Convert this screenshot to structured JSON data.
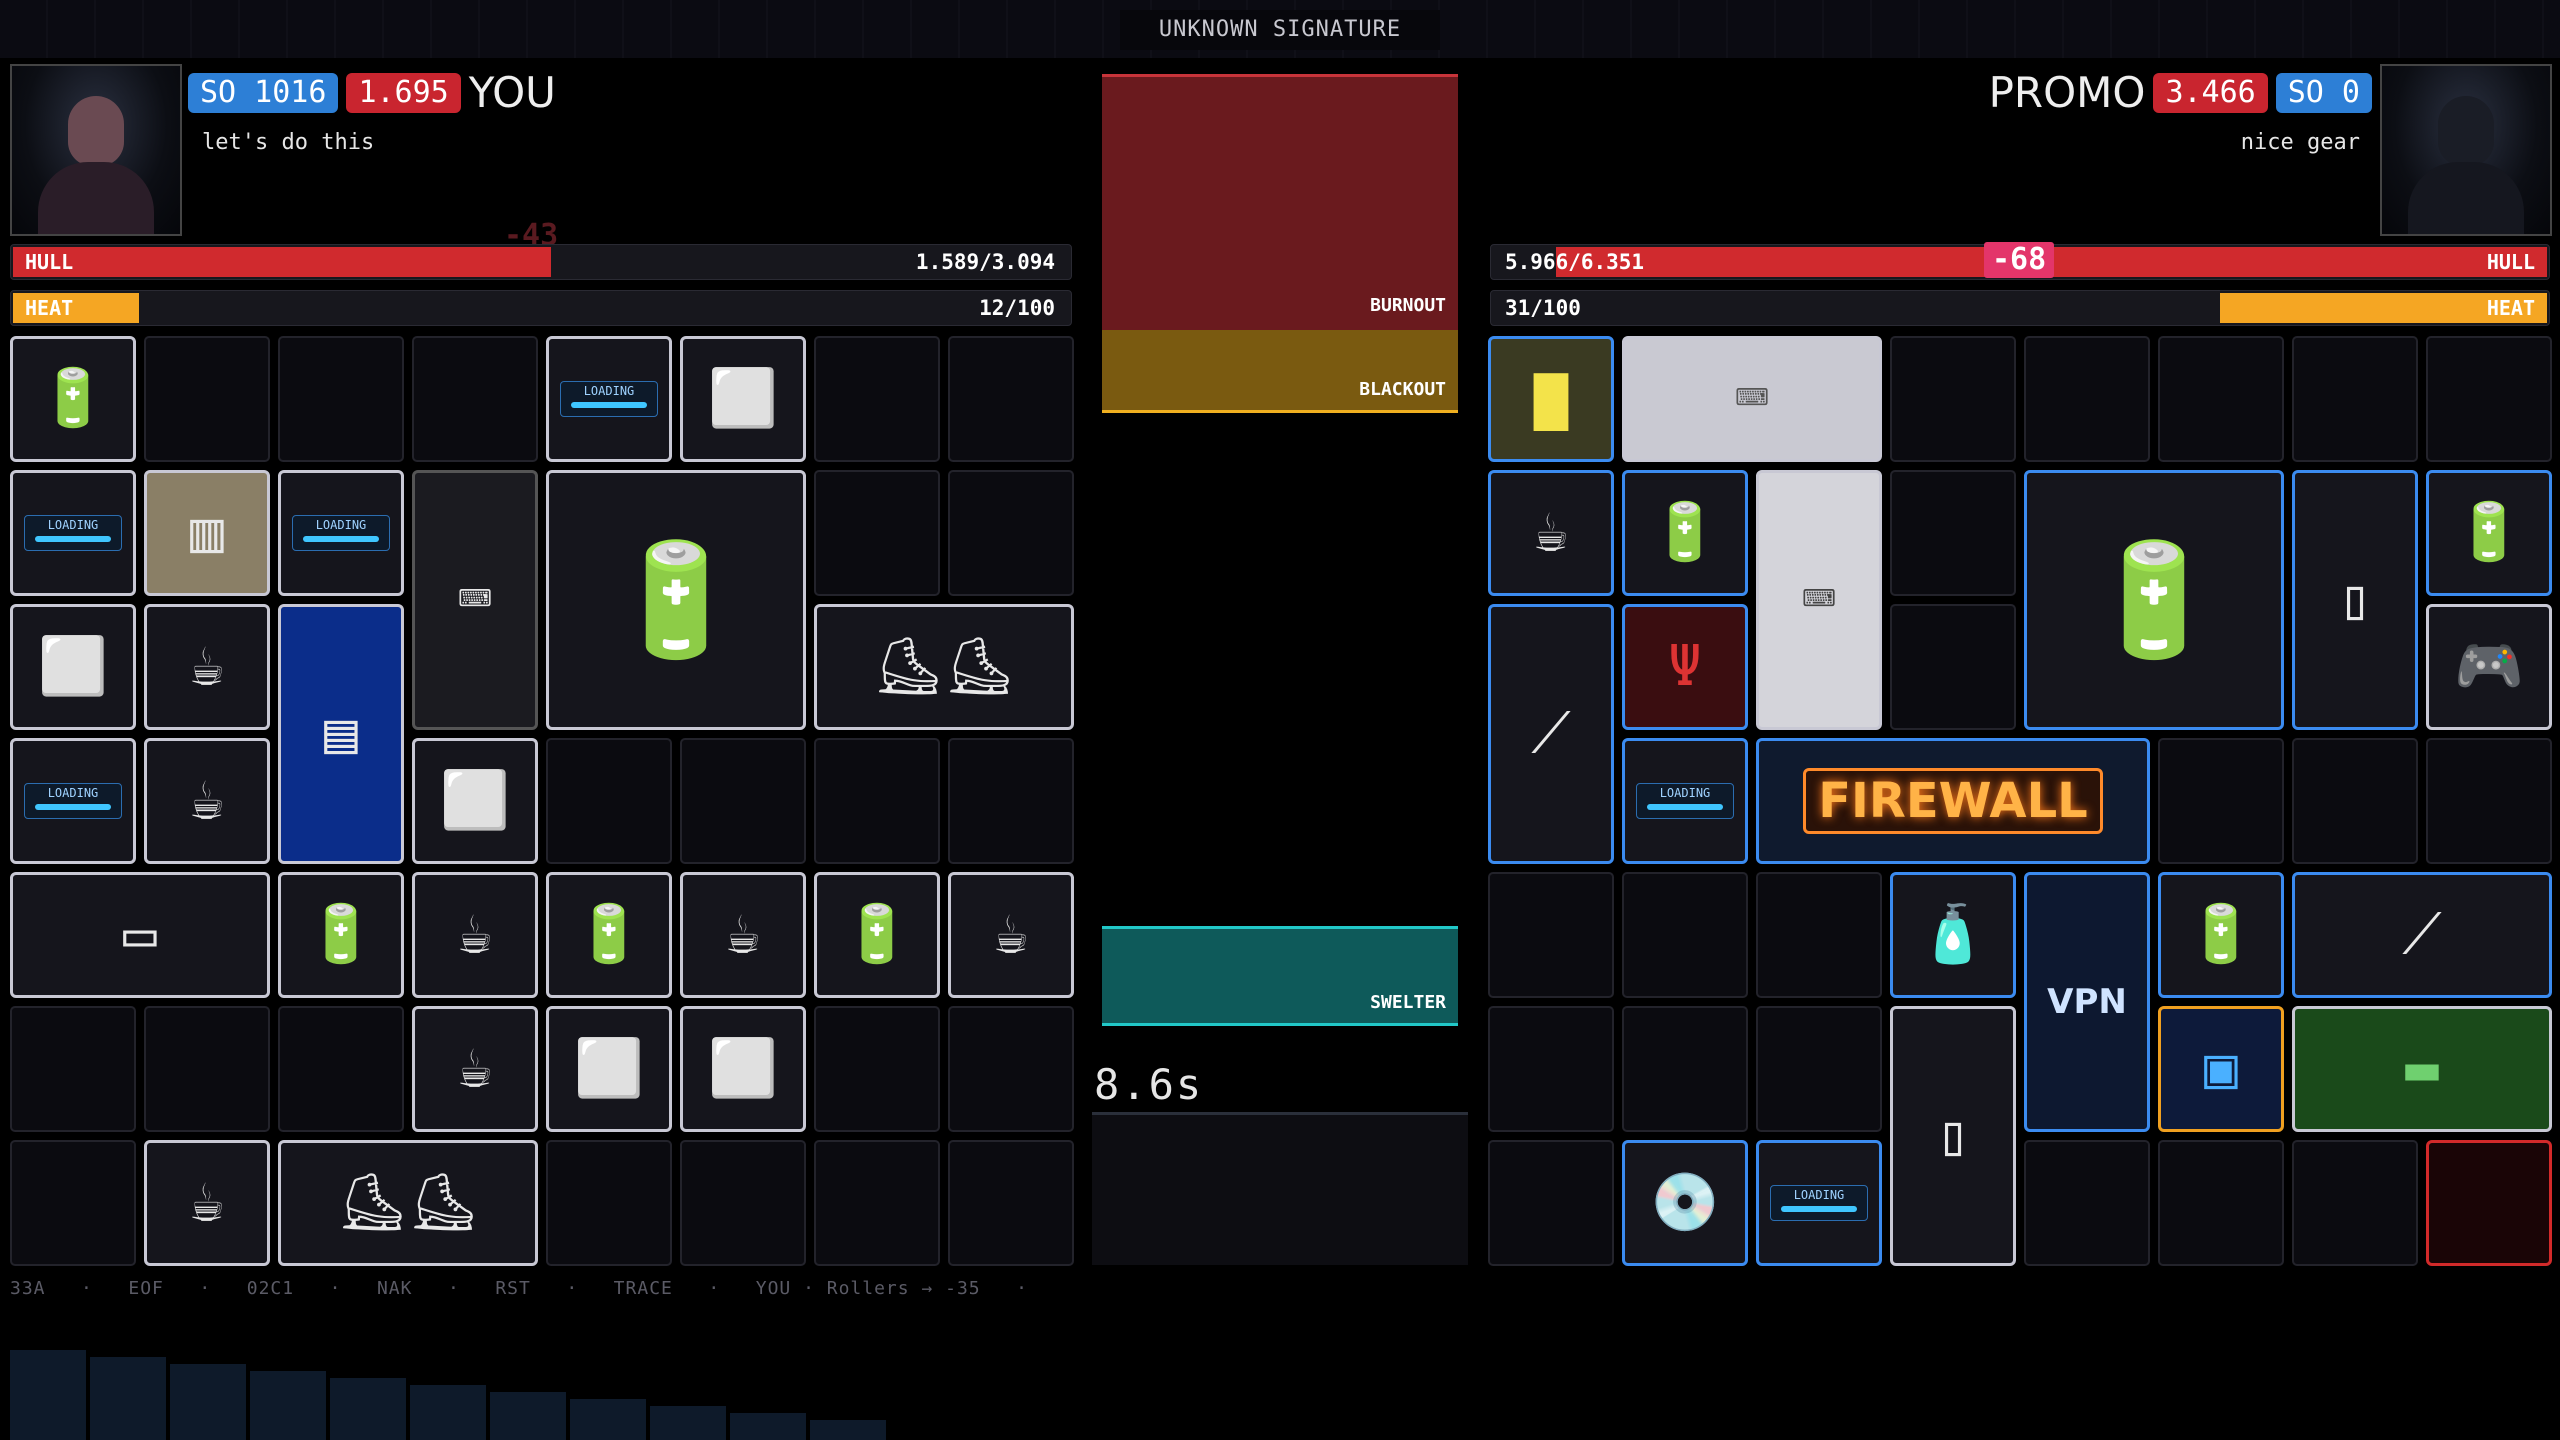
{
  "top_title": "UNKNOWN SIGNATURE",
  "player": {
    "name": "YOU",
    "so_badge": "SO 1016",
    "rating_badge": "1.695",
    "quote": "let's do this",
    "faded_damage": "-43",
    "hull_label": "HULL",
    "hull_value": "1.589/3.094",
    "hull_fraction": 0.51,
    "heat_label": "HEAT",
    "heat_value": "12/100",
    "heat_fraction": 0.12
  },
  "opponent": {
    "name": "PROMO",
    "rating_badge": "3.466",
    "so_badge": "SO 0",
    "quote": "nice gear",
    "hull_label": "HULL",
    "hull_value": "5.966/6.351",
    "hull_fraction": 0.94,
    "damage_popup": "-68",
    "heat_label": "HEAT",
    "heat_value": "31/100",
    "heat_fraction": 0.31
  },
  "meters": {
    "burnout": "BURNOUT",
    "blackout": "BLACKOUT",
    "swelter": "SWELTER",
    "timer": "8.6s"
  },
  "ticker": "33A   ·   EOF   ·   02C1   ·   NAK   ·   RST   ·   TRACE   ·   YOU · Rollers → -35   ·",
  "items": {
    "firewall": "FIREWALL",
    "vpn": "VPN",
    "loading": "LOADING"
  },
  "icons": [
    "battery-icon",
    "crate-icon",
    "mug-icon",
    "keyboard-icon",
    "car-battery-icon",
    "roller-skates-icon",
    "router-icon",
    "sponge-icon",
    "cd-icon",
    "trident-icon",
    "gamepad-icon",
    "chip-icon",
    "hose-icon",
    "oil-bottle-icon",
    "pc-tower-icon",
    "book-icon"
  ]
}
